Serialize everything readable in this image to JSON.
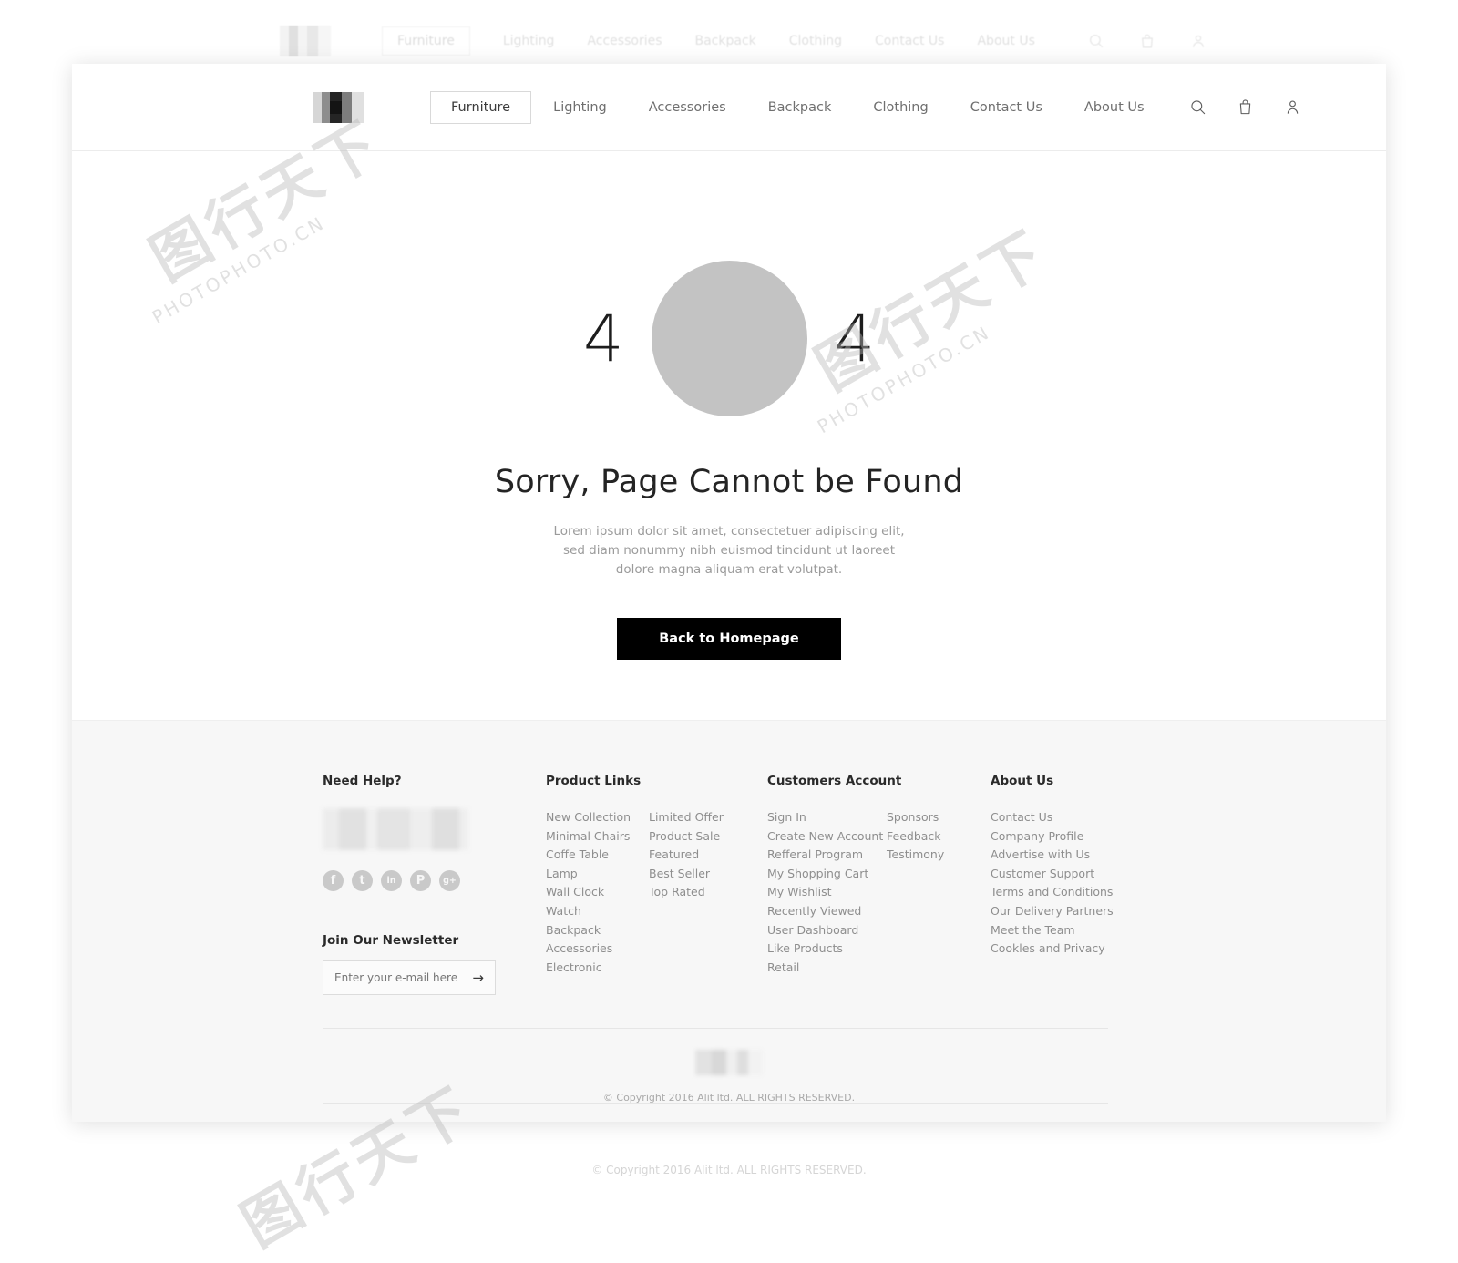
{
  "header": {
    "logo_name": "brand-logo",
    "nav": [
      {
        "label": "Furniture",
        "active": true
      },
      {
        "label": "Lighting",
        "active": false
      },
      {
        "label": "Accessories",
        "active": false
      },
      {
        "label": "Backpack",
        "active": false
      },
      {
        "label": "Clothing",
        "active": false
      },
      {
        "label": "Contact Us",
        "active": false
      },
      {
        "label": "About Us",
        "active": false
      }
    ],
    "icons": [
      "search-icon",
      "shopping-bag-icon",
      "user-account-icon"
    ]
  },
  "hero": {
    "digit_left": "4",
    "digit_right": "4",
    "zero_shape": "gray-circle",
    "title": "Sorry, Page Cannot be Found",
    "paragraph": "Lorem ipsum dolor sit amet, consectetuer adipiscing elit, sed diam nonummy nibh euismod tincidunt ut laoreet dolore magna aliquam erat volutpat.",
    "button_label": "Back to Homepage",
    "button_color": "#000000"
  },
  "footer": {
    "help": {
      "title": "Need Help?",
      "contact_block": "blurred-contact-info",
      "socials": [
        {
          "name": "facebook-icon",
          "glyph": "f"
        },
        {
          "name": "twitter-icon",
          "glyph": "t"
        },
        {
          "name": "linkedin-icon",
          "glyph": "in"
        },
        {
          "name": "pinterest-icon",
          "glyph": "P"
        },
        {
          "name": "google-plus-icon",
          "glyph": "g+"
        }
      ],
      "newsletter_title": "Join Our Newsletter",
      "newsletter_placeholder": "Enter your e-mail here",
      "newsletter_value": "",
      "newsletter_submit": "→"
    },
    "product_links": {
      "title": "Product Links",
      "col1": [
        "New Collection",
        "Minimal Chairs",
        "Coffe Table",
        "Lamp",
        "Wall Clock",
        "Watch",
        "Backpack",
        "Accessories",
        "Electronic"
      ],
      "col2": [
        "Limited Offer",
        "Product Sale",
        "Featured",
        "Best Seller",
        "Top Rated"
      ]
    },
    "customers_account": {
      "title": "Customers Account",
      "col1": [
        "Sign In",
        "Create New Account",
        "Refferal Program",
        "My Shopping Cart",
        "My Wishlist",
        "Recently Viewed",
        "User Dashboard",
        "Like Products",
        "Retail"
      ],
      "col2": [
        "Sponsors",
        "Feedback",
        "Testimony"
      ]
    },
    "about": {
      "title": "About Us",
      "items": [
        "Contact Us",
        "Company Profile",
        "Advertise with Us",
        "Customer Support",
        "Terms and Conditions",
        "Our Delivery Partners",
        "Meet the Team",
        "Cookles and Privacy"
      ]
    },
    "bottom_logo": "blurred-footer-logo",
    "copyright": "© Copyright 2016 Alit ltd. ALL RIGHTS RESERVED."
  },
  "backdrop": {
    "nav": [
      "Furniture",
      "Lighting",
      "Accessories",
      "Backpack",
      "Clothing",
      "Contact Us",
      "About Us"
    ],
    "copyright": "© Copyright 2016 Alit ltd. ALL RIGHTS RESERVED."
  },
  "watermark": {
    "cn": "图行天下",
    "en": "PHOTOPHOTO.CN"
  }
}
